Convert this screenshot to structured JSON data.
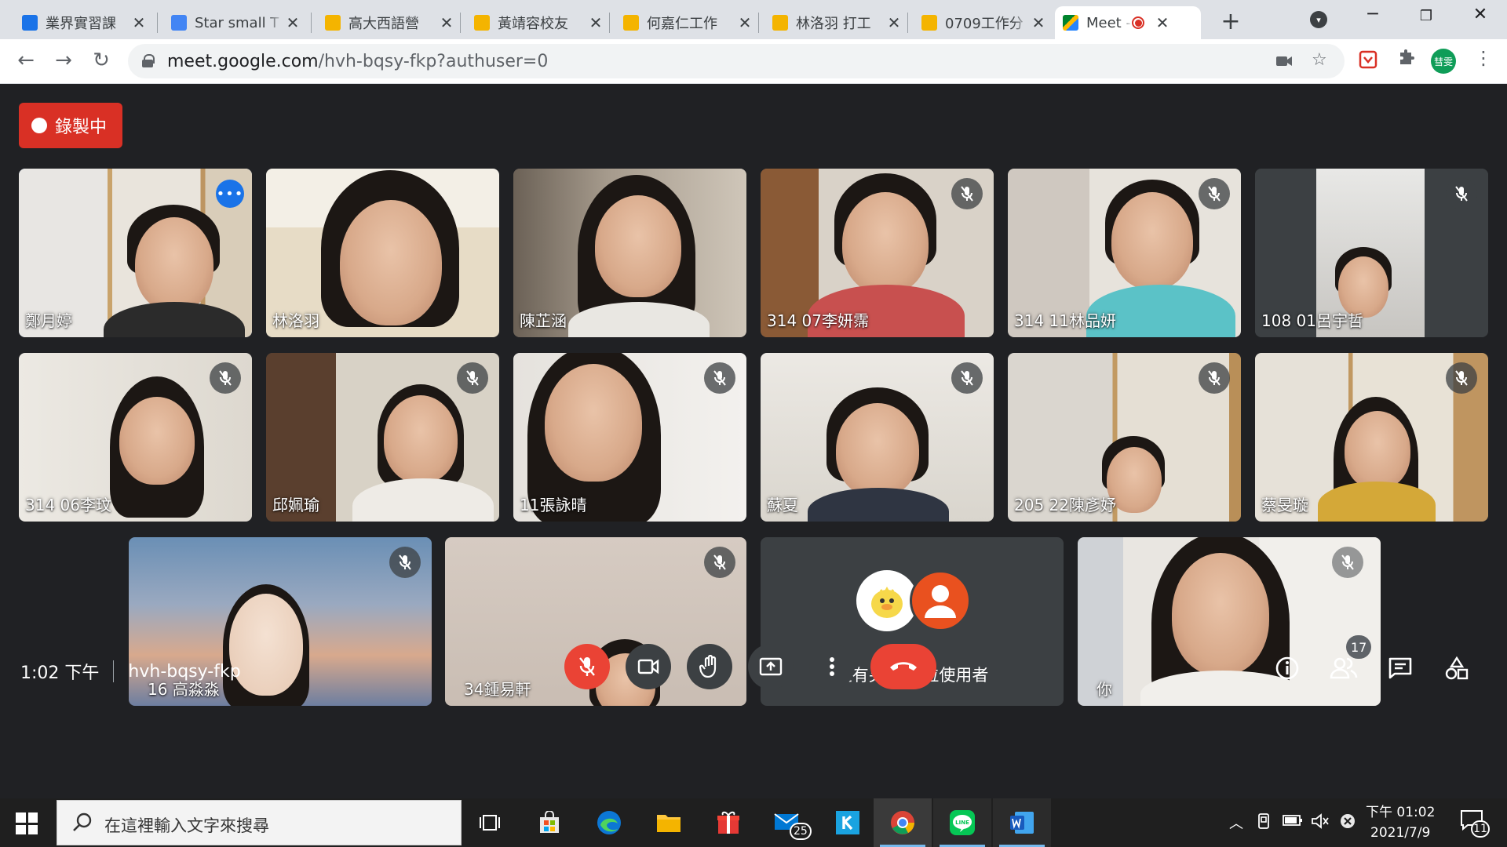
{
  "browser": {
    "tabs": [
      {
        "title": "業界實習課",
        "color": "#1a73e8"
      },
      {
        "title": "Star small T",
        "color": "#4285f4"
      },
      {
        "title": "高大西語營",
        "color": "#f4b400"
      },
      {
        "title": "黃靖容校友",
        "color": "#f4b400"
      },
      {
        "title": "何嘉仁工作",
        "color": "#f4b400"
      },
      {
        "title": "林洛羽 打工",
        "color": "#f4b400"
      },
      {
        "title": "0709工作分",
        "color": "#f4b400"
      },
      {
        "title": "Meet -",
        "color": "#00897b"
      }
    ],
    "url_host": "meet.google.com",
    "url_path": "/hvh-bqsy-fkp?authuser=0",
    "profile_initials": "彗雯"
  },
  "meet": {
    "recording_label": "錄製中",
    "participants": [
      {
        "name": "鄭月婷"
      },
      {
        "name": "林洛羽"
      },
      {
        "name": "陳芷涵"
      },
      {
        "name": "314 07李妍霈"
      },
      {
        "name": "314 11林品妍"
      },
      {
        "name": "108 01呂宇哲"
      },
      {
        "name": "314 06李玟"
      },
      {
        "name": "邱姵瑜"
      },
      {
        "name": "11張詠晴"
      },
      {
        "name": "蘇夏"
      },
      {
        "name": "205 22陳彥妤"
      },
      {
        "name": "蔡旻璇"
      },
      {
        "name": "16 高淼淼"
      },
      {
        "name": "34鍾易軒"
      },
      {
        "name": "你"
      }
    ],
    "others_label": "還有另外 2 位使用者",
    "time": "1:02 下午",
    "meeting_code": "hvh-bqsy-fkp",
    "people_count": "17"
  },
  "taskbar": {
    "search_placeholder": "在這裡輸入文字來搜尋",
    "mail_badge": "25",
    "clock_time": "下午 01:02",
    "clock_date": "2021/7/9",
    "notification_count": "11"
  }
}
